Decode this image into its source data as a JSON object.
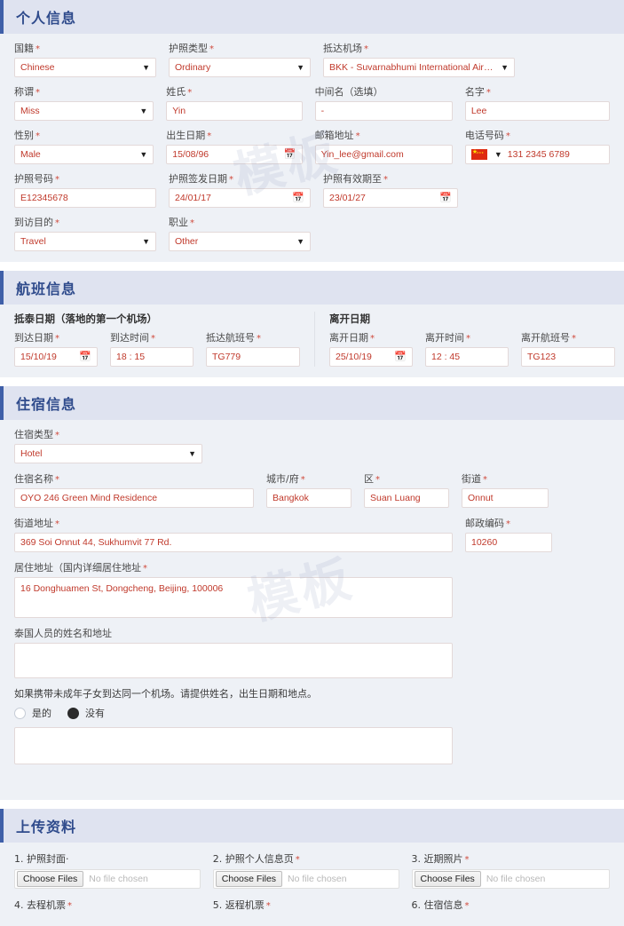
{
  "watermark": {
    "text": "模板"
  },
  "colors": {
    "section_header_bg": "#dfe3f0",
    "section_header_text": "#2f4b8c",
    "accent_bar": "#3f5fa8",
    "body_bg": "#eef1f6",
    "value_text": "#c0392b",
    "required_star": "#d04a3c"
  },
  "required_mark": "*",
  "sections": {
    "personal": {
      "title": "个人信息",
      "fields": {
        "nationality": {
          "label": "国籍",
          "value": "Chinese"
        },
        "passport_type": {
          "label": "护照类型",
          "value": "Ordinary"
        },
        "arrival_airport": {
          "label": "抵达机场",
          "value": "BKK - Suvarnabhumi International Airport"
        },
        "title_honorific": {
          "label": "称谓",
          "value": "Miss"
        },
        "surname": {
          "label": "姓氏",
          "value": "Yin"
        },
        "middle_name": {
          "label": "中间名（选填）",
          "value": "-"
        },
        "given_name": {
          "label": "名字",
          "value": "Lee"
        },
        "gender": {
          "label": "性别",
          "value": "Male"
        },
        "birth_date": {
          "label": "出生日期",
          "value": "15/08/96"
        },
        "email": {
          "label": "邮箱地址",
          "value": "Yin_lee@gmail.com"
        },
        "phone": {
          "label": "电话号码",
          "value": "131 2345 6789",
          "country_flag": "cn-flag-icon"
        },
        "passport_number": {
          "label": "护照号码",
          "value": "E12345678"
        },
        "passport_issue_date": {
          "label": "护照签发日期",
          "value": "24/01/17"
        },
        "passport_expiry_date": {
          "label": "护照有效期至",
          "value": "23/01/27"
        },
        "purpose_of_visit": {
          "label": "到访目的",
          "value": "Travel"
        },
        "occupation": {
          "label": "职业",
          "value": "Other"
        }
      }
    },
    "flight": {
      "title": "航班信息",
      "arrival_group_title": "抵泰日期（落地的第一个机场）",
      "departure_group_title": "离开日期",
      "fields": {
        "arrival_date": {
          "label": "到达日期",
          "value": "15/10/19"
        },
        "arrival_time": {
          "label": "到达时间",
          "value": "18 : 15"
        },
        "arrival_flight_no": {
          "label": "抵达航班号",
          "value": "TG779"
        },
        "departure_date": {
          "label": "离开日期",
          "value": "25/10/19"
        },
        "departure_time": {
          "label": "离开时间",
          "value": "12 : 45"
        },
        "departure_flight_no": {
          "label": "离开航班号",
          "value": "TG123"
        }
      }
    },
    "accommodation": {
      "title": "住宿信息",
      "fields": {
        "accommodation_type": {
          "label": "住宿类型",
          "value": "Hotel"
        },
        "accommodation_name": {
          "label": "住宿名称",
          "value": "OYO 246 Green Mind Residence"
        },
        "city": {
          "label": "城市/府",
          "value": "Bangkok"
        },
        "district": {
          "label": "区",
          "value": "Suan Luang"
        },
        "street": {
          "label": "街道",
          "value": "Onnut"
        },
        "street_address": {
          "label": "街道地址",
          "value": "369 Soi Onnut 44, Sukhumvit 77 Rd."
        },
        "postal_code": {
          "label": "邮政编码",
          "value": "10260"
        },
        "home_address": {
          "label": "居住地址（国内详细居住地址",
          "value": "16 Donghuamen St, Dongcheng, Beijing, 100006"
        },
        "thai_contact": {
          "label": "泰国人员的姓名和地址",
          "value": ""
        },
        "minor_notes": {
          "value": ""
        }
      },
      "minor_question": "如果携带未成年子女到达同一个机场。请提供姓名，出生日期和地点。",
      "radio_yes": "是的",
      "radio_no": "没有",
      "radio_selected": "no"
    },
    "upload": {
      "title": "上传资料",
      "choose_button": "Choose Files",
      "no_file_text": "No file chosen",
      "items": [
        {
          "label": "1. 护照封面·",
          "required": false
        },
        {
          "label": "2. 护照个人信息页",
          "required": true
        },
        {
          "label": "3. 近期照片",
          "required": true
        },
        {
          "label": "4. 去程机票",
          "required": true
        },
        {
          "label": "5. 返程机票",
          "required": true
        },
        {
          "label": "6. 住宿信息",
          "required": true
        }
      ]
    }
  }
}
